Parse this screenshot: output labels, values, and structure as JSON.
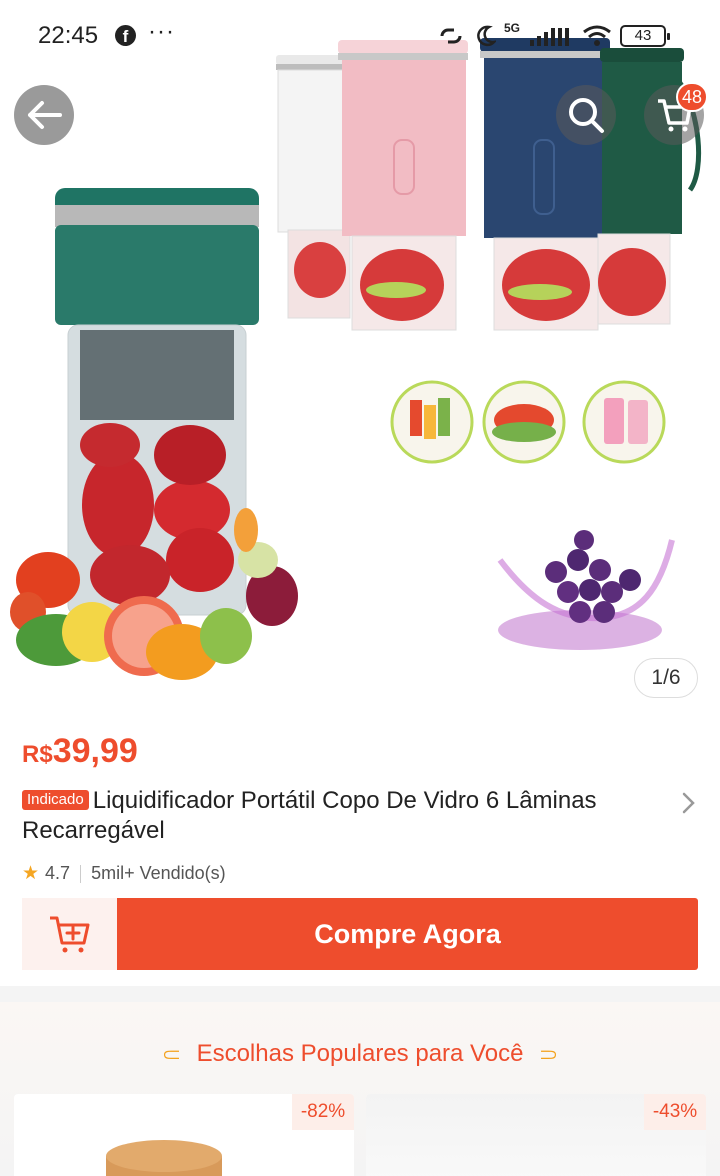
{
  "status_bar": {
    "time": "22:45",
    "fb_glyph": "f",
    "more": "···",
    "battery": "43",
    "network": "5G",
    "icons": [
      "facebook-icon",
      "more-icon",
      "link-icon",
      "moon-icon",
      "signal-icon",
      "wifi-icon",
      "battery-icon"
    ]
  },
  "header": {
    "back_icon": "arrow-left-icon",
    "search_icon": "search-icon",
    "cart_icon": "cart-icon",
    "cart_badge": "48"
  },
  "gallery": {
    "counter": "1/6"
  },
  "product": {
    "price_currency": "R$",
    "price_value": "39,99",
    "tag": "Indicado",
    "title": "Liquidificador Portátil Copo De Vidro 6 Lâminas Recarregável",
    "rating": "4.7",
    "sold": "5mil+ Vendido(s)"
  },
  "actions": {
    "add_to_cart_icon": "add-to-cart-icon",
    "buy_now": "Compre Agora"
  },
  "popular": {
    "title": "Escolhas Populares para Você",
    "cards": [
      {
        "discount": "-82%"
      },
      {
        "discount": "-43%"
      }
    ]
  },
  "colors": {
    "accent": "#ee4d2d",
    "star": "#f5a623",
    "blender_green": "#2a7a6a",
    "blender_pink": "#f2bcc4",
    "blender_navy": "#2a4670",
    "blender_dark_green": "#1f5a45"
  }
}
